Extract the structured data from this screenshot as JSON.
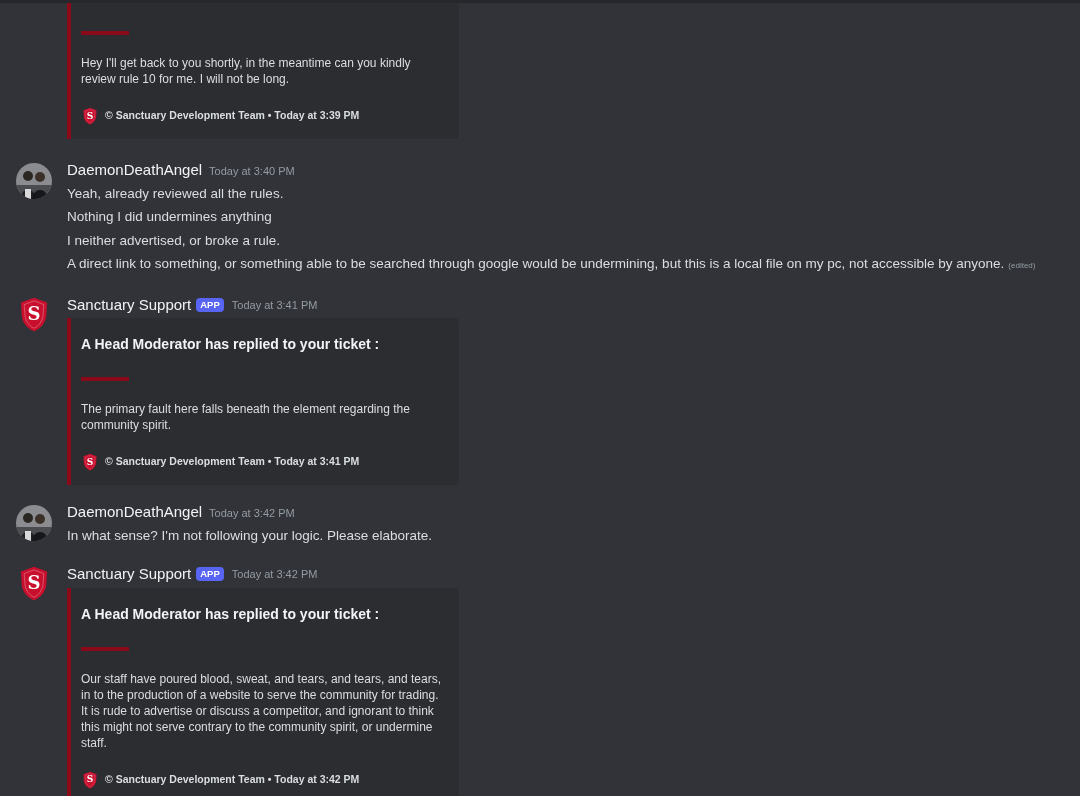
{
  "messages": [
    {
      "kind": "embed_only",
      "embed": {
        "description": "Hey I'll get back to you shortly, in the meantime can you kindly review rule 10 for me. I will not be long.",
        "footer_letter": "S",
        "footer": "© Sanctuary Development Team • Today at 3:39 PM"
      }
    },
    {
      "kind": "user",
      "author": "DaemonDeathAngel",
      "time": "Today at 3:40 PM",
      "lines": [
        "Yeah, already reviewed all the rules.",
        "Nothing I did undermines anything",
        "I neither advertised, or broke a rule.",
        "A direct link to something, or something able to be searched through google would be undermining, but this is a local file on my pc, not accessible by anyone."
      ],
      "edited": "(edited)"
    },
    {
      "kind": "bot",
      "author": "Sanctuary Support",
      "avatar_letter": "S",
      "tag": "APP",
      "time": "Today at 3:41 PM",
      "embed": {
        "title": "A Head Moderator has replied to your ticket :",
        "description": "The primary fault here falls beneath the element regarding the community spirit.",
        "footer_letter": "S",
        "footer": "© Sanctuary Development Team • Today at 3:41 PM"
      }
    },
    {
      "kind": "user",
      "author": "DaemonDeathAngel",
      "time": "Today at 3:42 PM",
      "lines": [
        "In what sense? I'm not following your logic. Please elaborate."
      ]
    },
    {
      "kind": "bot",
      "author": "Sanctuary Support",
      "avatar_letter": "S",
      "tag": "APP",
      "time": "Today at 3:42 PM",
      "embed": {
        "title": "A Head Moderator has replied to your ticket :",
        "description": "Our staff have poured blood, sweat, and tears, and tears, and tears, in to the production of a website to serve the community for trading. It is rude to advertise or discuss a competitor, and ignorant to think this might not serve contrary to the community spirit, or undermine staff.",
        "footer_letter": "S",
        "footer": "© Sanctuary Development Team • Today at 3:42 PM"
      }
    }
  ]
}
